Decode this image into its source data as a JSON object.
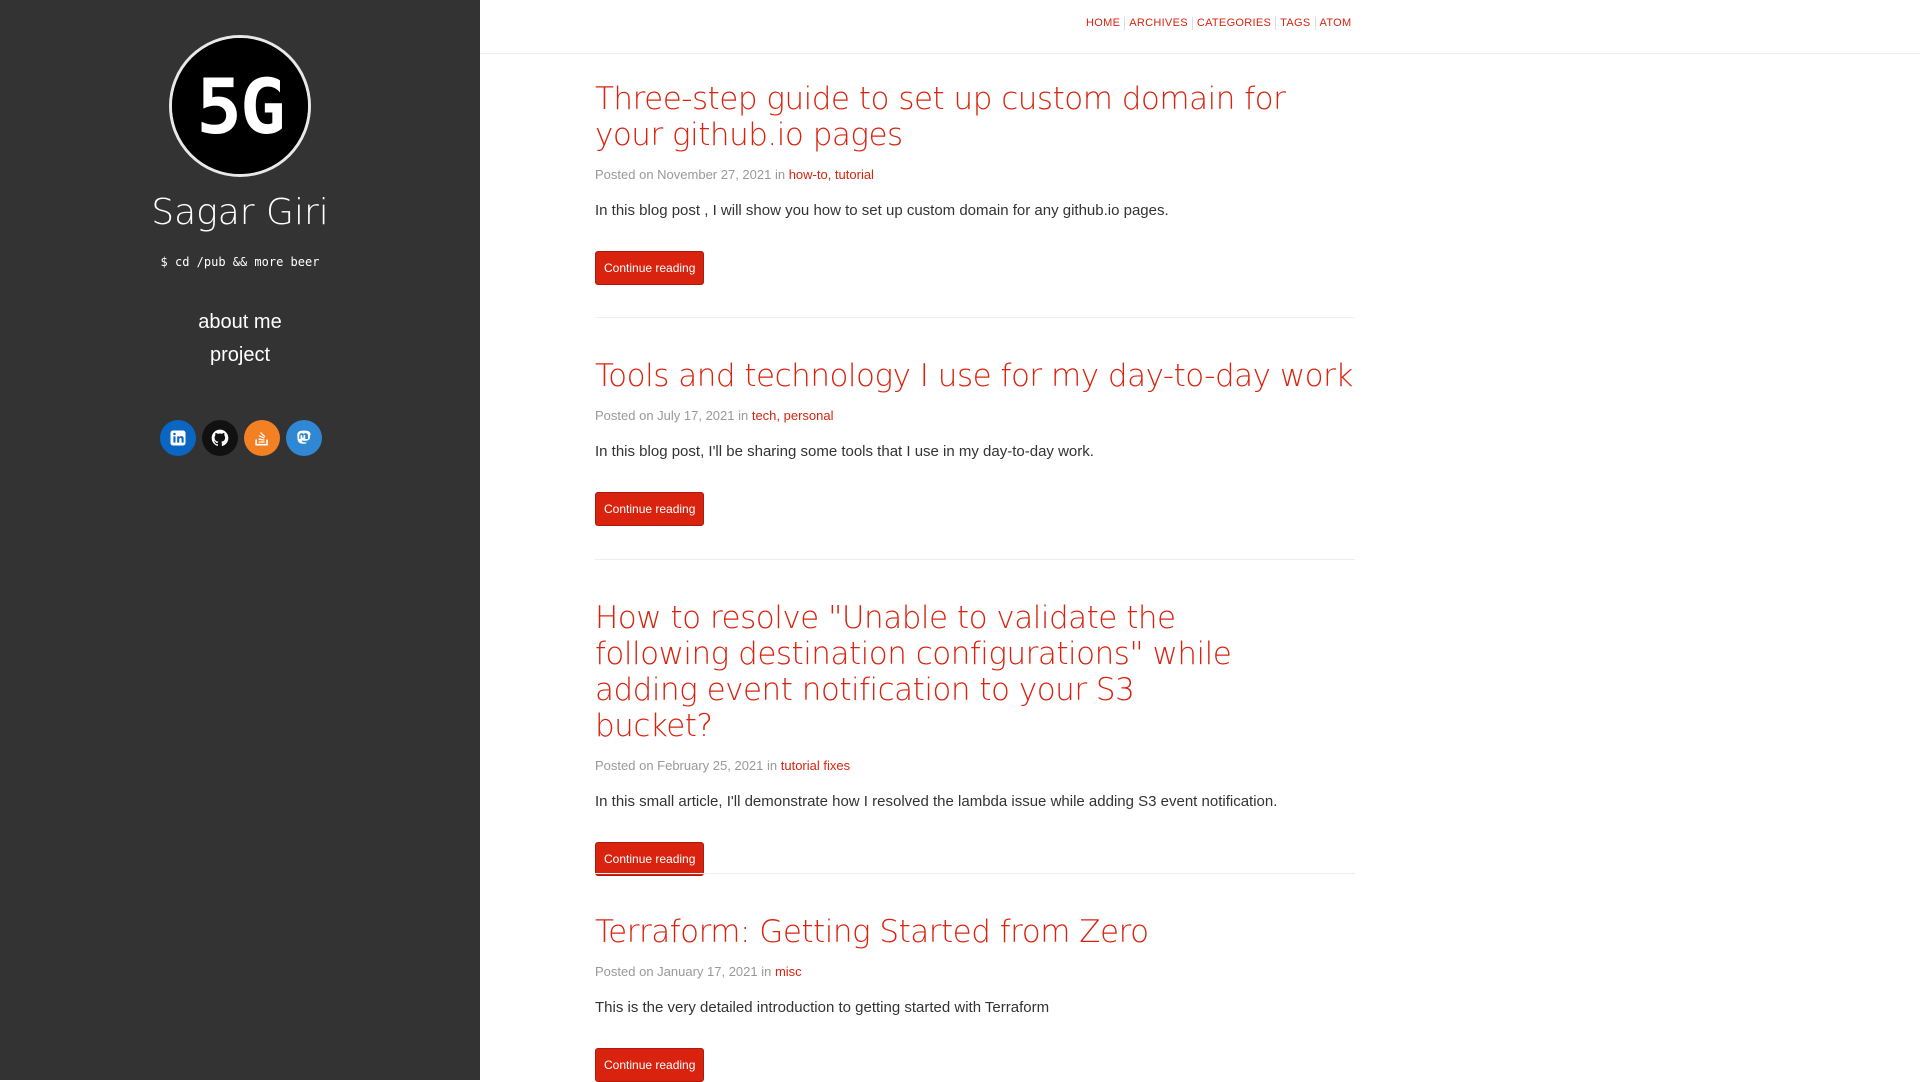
{
  "sidebar": {
    "avatar_text": "5G",
    "site_name": "Sagar Giri",
    "tagline": "$ cd /pub && more beer",
    "nav": [
      {
        "label": "about me"
      },
      {
        "label": "project"
      }
    ],
    "socials": [
      {
        "icon": "linkedin-icon",
        "color": "#0a66c2"
      },
      {
        "icon": "github-icon",
        "color": "#111111"
      },
      {
        "icon": "stackoverflow-icon",
        "color": "#f48024"
      },
      {
        "icon": "mastodon-icon",
        "color": "#3088d4"
      }
    ]
  },
  "top_nav": [
    "HOME",
    "ARCHIVES",
    "CATEGORIES",
    "TAGS",
    "ATOM"
  ],
  "posts": [
    {
      "title": "Three-step guide to set up custom domain for your github.io pages",
      "posted_prefix": "Posted on November 27, 2021 in ",
      "categories": "how-to, tutorial",
      "excerpt": "In this blog post , I will show you how to set up custom domain for any github.io pages.",
      "button": "Continue reading"
    },
    {
      "title": "Tools and technology I use for my day-to-day work",
      "posted_prefix": "Posted on July 17, 2021 in ",
      "categories": "tech, personal",
      "excerpt": "In this blog post, I'll be sharing some tools that I use in my day-to-day work.",
      "button": "Continue reading"
    },
    {
      "title": "How to resolve \"Unable to validate the following destination configurations\" while adding event notification to your S3 bucket?",
      "posted_prefix": "Posted on February 25, 2021 in ",
      "categories": "tutorial fixes",
      "excerpt": "In this small article, I'll demonstrate how I resolved the lambda issue while adding S3 event notification.",
      "button": "Continue reading"
    },
    {
      "title": "Terraform: Getting Started from Zero",
      "posted_prefix": "Posted on January 17, 2021 in ",
      "categories": "misc",
      "excerpt": "This is the very detailed introduction to getting started with Terraform",
      "button": "Continue reading"
    }
  ],
  "colors": {
    "accent": "#d9230f",
    "sidebar_bg": "#333333",
    "meta_text": "#999999"
  }
}
